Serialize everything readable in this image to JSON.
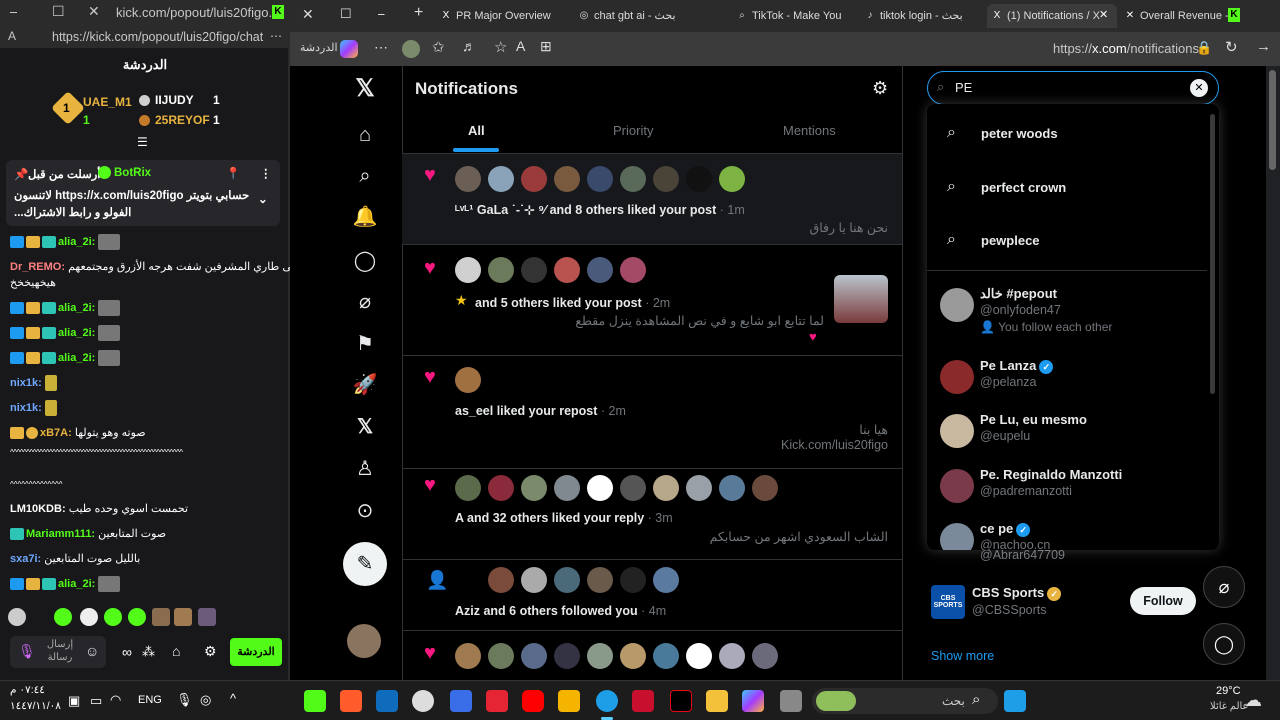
{
  "kick": {
    "title": "kick.com/popout/luis20figo...",
    "url": "https://kick.com/popout/luis20figo/chat",
    "header": "الدردشة",
    "leaderboard": [
      {
        "name": "UAE_M1",
        "value": "1",
        "rank": "1"
      },
      {
        "name": "IIJUDY",
        "value": "1"
      },
      {
        "name": "25REYOF",
        "value": "1"
      }
    ],
    "pinned": {
      "author_line": "أرسلت من قبل",
      "author": "BotRix",
      "text1": "لاتنسون https://x.com/luis20figo حسابي بتويتر",
      "text2": "...الفولو و رابط الاشتراك"
    },
    "messages": [
      {
        "user": "alia_2i:",
        "text": ""
      },
      {
        "user": "Dr_REMO:",
        "text": "على طاري المشرفين شفت هرجه الأزرق ومجتمعهم"
      },
      {
        "user": "",
        "text": "هيخهيخخخ"
      },
      {
        "user": "alia_2i:",
        "text": ""
      },
      {
        "user": "alia_2i:",
        "text": ""
      },
      {
        "user": "alia_2i:",
        "text": ""
      },
      {
        "user": "nix1k:",
        "text": ""
      },
      {
        "user": "nix1k:",
        "text": ""
      },
      {
        "user": "xB7A:",
        "text": "صوته وهو يتولها"
      },
      {
        "user": "",
        "text": "^^^^^^^^^^^^^^^^^^^^^^^^^^^^^^^^^^^^^^^^^^^^^^^^^^^^^"
      },
      {
        "user": "",
        "text": "^^^^^^^^^^^^^^"
      },
      {
        "user": "LM10KDB:",
        "text": "تحمست اسوي وحده طيب"
      },
      {
        "user": "Mariamm111:",
        "text": "صوت المتابعين"
      },
      {
        "user": "sxa7i:",
        "text": "بالليل صوت المتابعين"
      },
      {
        "user": "alia_2i:",
        "text": ""
      }
    ],
    "send_placeholder": "إرسال رسالة",
    "chat_button": "الدردشة"
  },
  "browser": {
    "tabs": [
      {
        "label": "PR Major Overview",
        "icon": "X"
      },
      {
        "label": "chat gbt ai - بحث",
        "icon": "◎"
      },
      {
        "label": "TikTok - Make You",
        "icon": "♪"
      },
      {
        "label": "tiktok login - بحث",
        "icon": "⌕"
      },
      {
        "label": "(1) Notifications / X",
        "icon": "X"
      },
      {
        "label": "Overall Revenue -",
        "icon": "K"
      }
    ],
    "chat_label": "الدردشة",
    "url_prefix": "https://",
    "url_host": "x.com",
    "url_path": "/notifications"
  },
  "x": {
    "notification_badge": "1",
    "title": "Notifications",
    "tabs": [
      "All",
      "Priority",
      "Mentions"
    ],
    "notifications": [
      {
        "text": "ᴸᵛᴸ¹ GaLa ˙-˙⊹ ⁹⁄ and 8 others liked your post",
        "time": "· 1m",
        "quote": "نحن هنا يا رفاق"
      },
      {
        "text": "and 5 others liked your post",
        "time": "· 2m",
        "quote": "لما تتابع ابو شايع و في نص المشاهدة ينزل مقطع"
      },
      {
        "text": "as_eel liked your repost",
        "time": "· 2m",
        "quote": "هيا بنا",
        "quote2": "Kick.com/luis20figo"
      },
      {
        "text": "A and 32 others liked your reply",
        "time": "· 3m",
        "quote": "الشاب السعودي اشهر من حسابكم"
      },
      {
        "text": "Aziz and 6 others followed you",
        "time": "· 4m",
        "quote": ""
      }
    ],
    "search_value": "PE",
    "suggestions": [
      "peter woods",
      "perfect crown",
      "pewplece"
    ],
    "users": [
      {
        "name": "خالد #pepout",
        "handle": "@onlyfoden47",
        "extra": "You follow each other",
        "verified": ""
      },
      {
        "name": "Pe Lanza",
        "handle": "@pelanza",
        "extra": "",
        "verified": "blue"
      },
      {
        "name": "Pe Lu, eu mesmo",
        "handle": "@eupelu",
        "extra": "",
        "verified": ""
      },
      {
        "name": "Pe. Reginaldo Manzotti",
        "handle": "@padremanzotti",
        "extra": "",
        "verified": ""
      },
      {
        "name": "ce pe",
        "handle": "@nachoo.cn",
        "extra": "",
        "verified": "blue"
      }
    ],
    "behind_handle": "@Abrar647709",
    "who_to_follow": {
      "name": "CBS Sports",
      "handle": "@CBSSports",
      "button": "Follow",
      "logo": "CBS SPORTS"
    },
    "show_more": "Show more"
  },
  "taskbar": {
    "time": "٠٧:٤٤ م",
    "date": "١٤٤٧/١١/٠٨",
    "lang": "ENG",
    "search": "بحث",
    "temp": "29°C",
    "weather": "عالم غائلا"
  }
}
